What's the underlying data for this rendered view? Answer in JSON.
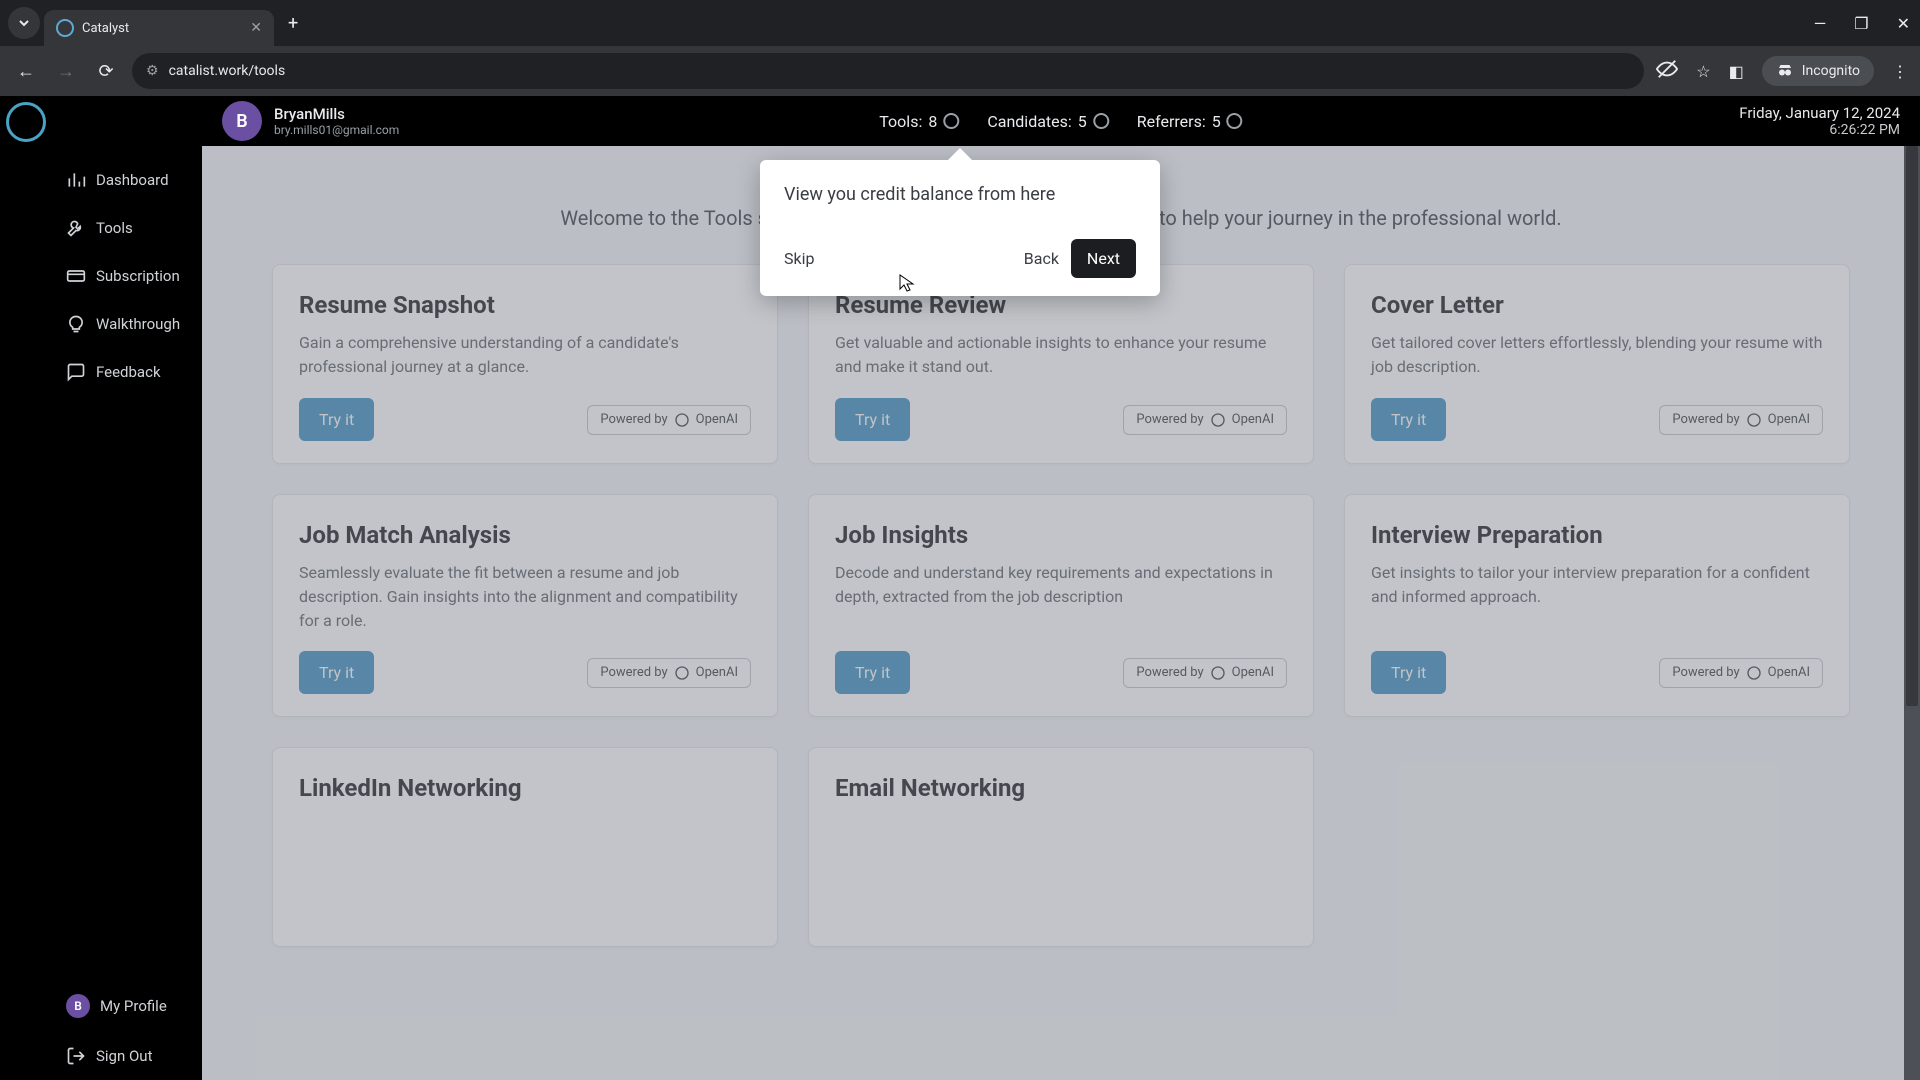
{
  "browser": {
    "tab_title": "Catalyst",
    "url": "catalist.work/tools",
    "incognito_label": "Incognito"
  },
  "sidebar": {
    "items": [
      {
        "label": "Dashboard"
      },
      {
        "label": "Tools"
      },
      {
        "label": "Subscription"
      },
      {
        "label": "Walkthrough"
      },
      {
        "label": "Feedback"
      }
    ],
    "profile_label": "My Profile",
    "profile_initial": "B",
    "signout_label": "Sign Out"
  },
  "header": {
    "avatar_initial": "B",
    "user_name": "BryanMills",
    "user_email": "bry.mills01@gmail.com",
    "stats": [
      {
        "label": "Tools:",
        "value": "8"
      },
      {
        "label": "Candidates:",
        "value": "5"
      },
      {
        "label": "Referrers:",
        "value": "5"
      }
    ],
    "date": "Friday, January 12, 2024",
    "time": "6:26:22 PM"
  },
  "main": {
    "welcome": "Welcome to the Tools sections, Bryan Mills! Here you can find tools to help your journey in the professional world.",
    "try_label": "Try it",
    "powered_label": "Powered by",
    "powered_brand": "OpenAI",
    "cards": [
      {
        "title": "Resume Snapshot",
        "desc": "Gain a comprehensive understanding of a candidate's professional journey at a glance."
      },
      {
        "title": "Resume Review",
        "desc": "Get valuable and actionable insights to enhance your resume and make it stand out."
      },
      {
        "title": "Cover Letter",
        "desc": "Get tailored cover letters effortlessly, blending your resume with job description."
      },
      {
        "title": "Job Match Analysis",
        "desc": "Seamlessly evaluate the fit between a resume and job description. Gain insights into the alignment and compatibility for a role."
      },
      {
        "title": "Job Insights",
        "desc": "Decode and understand key requirements and expectations in depth, extracted from the job description"
      },
      {
        "title": "Interview Preparation",
        "desc": "Get insights to tailor your interview preparation for a confident and informed approach."
      },
      {
        "title": "LinkedIn Networking",
        "desc": ""
      },
      {
        "title": "Email Networking",
        "desc": ""
      }
    ]
  },
  "tooltip": {
    "text": "View you credit balance from here",
    "skip": "Skip",
    "back": "Back",
    "next": "Next"
  }
}
